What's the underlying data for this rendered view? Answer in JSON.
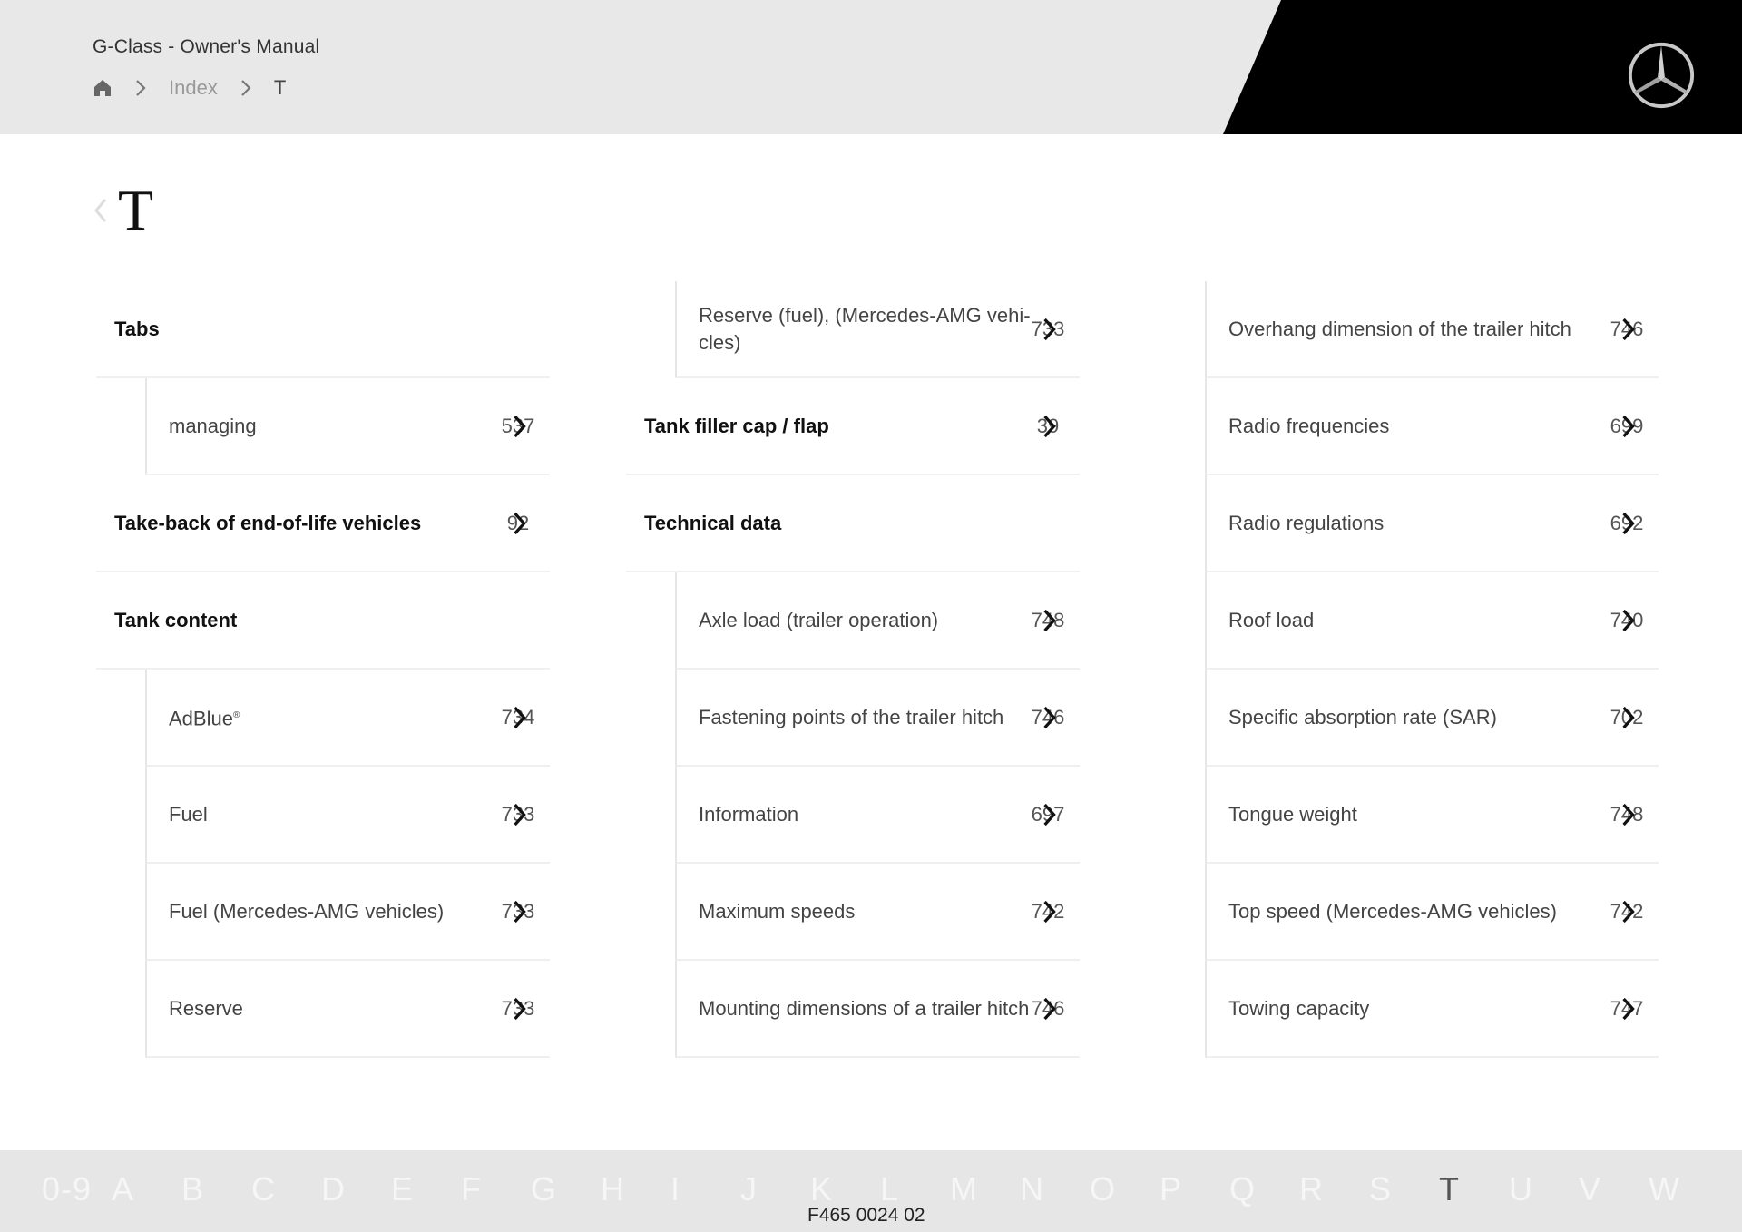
{
  "header": {
    "app_title": "G-Class - Owner's Manual",
    "breadcrumb": {
      "home_icon": "home-icon",
      "separator_icon": "chevron-right-icon",
      "items": [
        "Index",
        "T"
      ]
    },
    "logo": "mercedes-star-logo"
  },
  "section": {
    "back_icon": "chevron-left-icon",
    "title": "T"
  },
  "columns": [
    {
      "rows": [
        {
          "type": "heading",
          "label": "Tabs",
          "page": ""
        },
        {
          "type": "sub",
          "label": "managing",
          "page": "537"
        },
        {
          "type": "heading",
          "label": "Take-back of end-of-life vehicles",
          "page": "92"
        },
        {
          "type": "heading",
          "label": "Tank content",
          "page": ""
        },
        {
          "type": "sub",
          "label": "AdBlue",
          "label_sup": "®",
          "page": "734"
        },
        {
          "type": "sub",
          "label": "Fuel",
          "page": "733"
        },
        {
          "type": "sub",
          "label": "Fuel (Mercedes-AMG vehicles)",
          "page": "733"
        },
        {
          "type": "sub",
          "label": "Reserve",
          "page": "733"
        }
      ]
    },
    {
      "rows": [
        {
          "type": "sub",
          "label": "Reserve (fuel), (Mercedes-AMG vehi-cles)",
          "page": "733"
        },
        {
          "type": "heading",
          "label": "Tank filler cap / flap",
          "page": "39"
        },
        {
          "type": "heading",
          "label": "Technical data",
          "page": ""
        },
        {
          "type": "sub",
          "label": "Axle load (trailer operation)",
          "page": "748"
        },
        {
          "type": "sub",
          "label": "Fastening points of the trailer hitch",
          "page": "746"
        },
        {
          "type": "sub",
          "label": "Information",
          "page": "697"
        },
        {
          "type": "sub",
          "label": "Maximum speeds",
          "page": "742"
        },
        {
          "type": "sub",
          "label": "Mounting dimensions of a trailer hitch",
          "page": "746"
        }
      ]
    },
    {
      "rows": [
        {
          "type": "flat",
          "label": "Overhang dimension of the trailer hitch",
          "page": "746"
        },
        {
          "type": "flat",
          "label": "Radio frequencies",
          "page": "699"
        },
        {
          "type": "flat",
          "label": "Radio regulations",
          "page": "692"
        },
        {
          "type": "flat",
          "label": "Roof load",
          "page": "740"
        },
        {
          "type": "flat",
          "label": "Specific absorption rate (SAR)",
          "page": "702"
        },
        {
          "type": "flat",
          "label": "Tongue weight",
          "page": "748"
        },
        {
          "type": "flat",
          "label": "Top speed (Mercedes-AMG vehicles)",
          "page": "742"
        },
        {
          "type": "flat",
          "label": "Towing capacity",
          "page": "747"
        }
      ]
    }
  ],
  "row_icon": "chevron-right-icon",
  "footer": {
    "alphabet": [
      "0-9",
      "A",
      "B",
      "C",
      "D",
      "E",
      "F",
      "G",
      "H",
      "I",
      "J",
      "K",
      "L",
      "M",
      "N",
      "O",
      "P",
      "Q",
      "R",
      "S",
      "T",
      "U",
      "V",
      "W"
    ],
    "active": "T",
    "doc_id": "F465 0024 02"
  }
}
